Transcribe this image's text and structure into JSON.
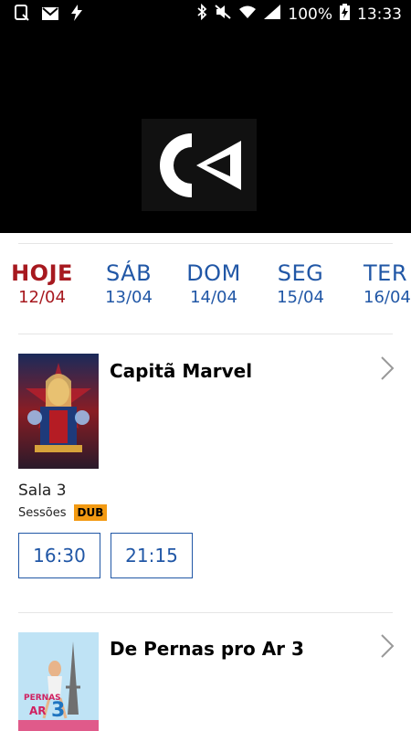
{
  "status_bar": {
    "battery": "100%",
    "time": "13:33"
  },
  "dates": [
    {
      "day": "HOJE",
      "date": "12/04",
      "active": true
    },
    {
      "day": "SÁB",
      "date": "13/04"
    },
    {
      "day": "DOM",
      "date": "14/04"
    },
    {
      "day": "SEG",
      "date": "15/04"
    },
    {
      "day": "TER",
      "date": "16/04"
    }
  ],
  "movies": [
    {
      "title": "Capitã Marvel",
      "room": "Sala 3",
      "sessions_label": "Sessões",
      "badge": "DUB",
      "times": [
        "16:30",
        "21:15"
      ]
    },
    {
      "title": "De Pernas pro Ar 3"
    }
  ],
  "colors": {
    "accent_blue": "#2157a6",
    "active_red": "#a7191f",
    "badge_orange": "#f39a12"
  }
}
